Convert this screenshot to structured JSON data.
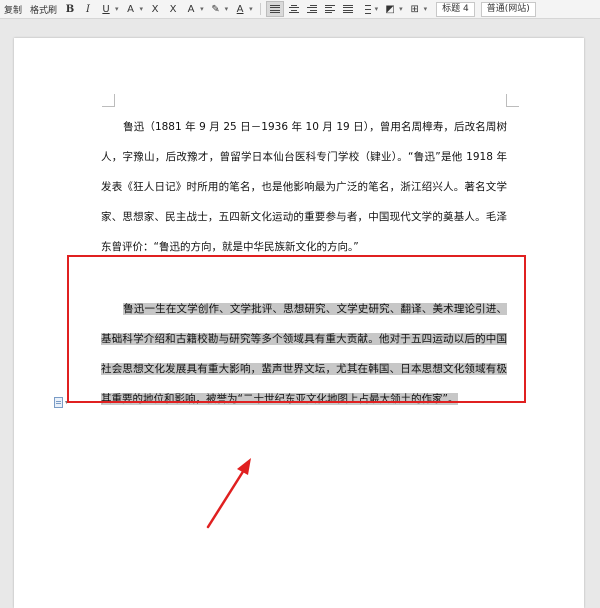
{
  "toolbar": {
    "copy_label": "复制",
    "format_painter_label": "格式刷",
    "bold_label": "B",
    "italic_label": "I",
    "underline_label": "U",
    "font_color_label": "A",
    "strike_label": "X",
    "superscript_label": "X",
    "highlight_label": "A",
    "char_border_label": "A",
    "style_heading": "标题 4",
    "style_normal": "普通(网站)",
    "accent_color": "#e02020"
  },
  "document": {
    "paragraph1": "鲁迅（1881 年 9 月 25 日－1936 年 10 月 19 日），曾用名周樟寿，后改名周树人，字豫山，后改豫才，曾留学日本仙台医科专门学校（肄业）。“鲁迅”是他 1918 年发表《狂人日记》时所用的笔名，也是他影响最为广泛的笔名，浙江绍兴人。著名文学家、思想家、民主战士，五四新文化运动的重要参与者，中国现代文学的奠基人。毛泽东曾评价：“鲁迅的方向，就是中华民族新文化的方向。”",
    "paragraph2": "鲁迅一生在文学创作、文学批评、思想研究、文学史研究、翻译、美术理论引进、基础科学介绍和古籍校勘与研究等多个领域具有重大贡献。他对于五四运动以后的中国社会思想文化发展具有重大影响，蜚声世界文坛，尤其在韩国、日本思想文化领域有极其重要的地位和影响，被誉为“二十世纪东亚文化地图上占最大领土的作家”。"
  },
  "annotation": {
    "box_color": "#e02020",
    "arrow_color": "#e02020"
  }
}
